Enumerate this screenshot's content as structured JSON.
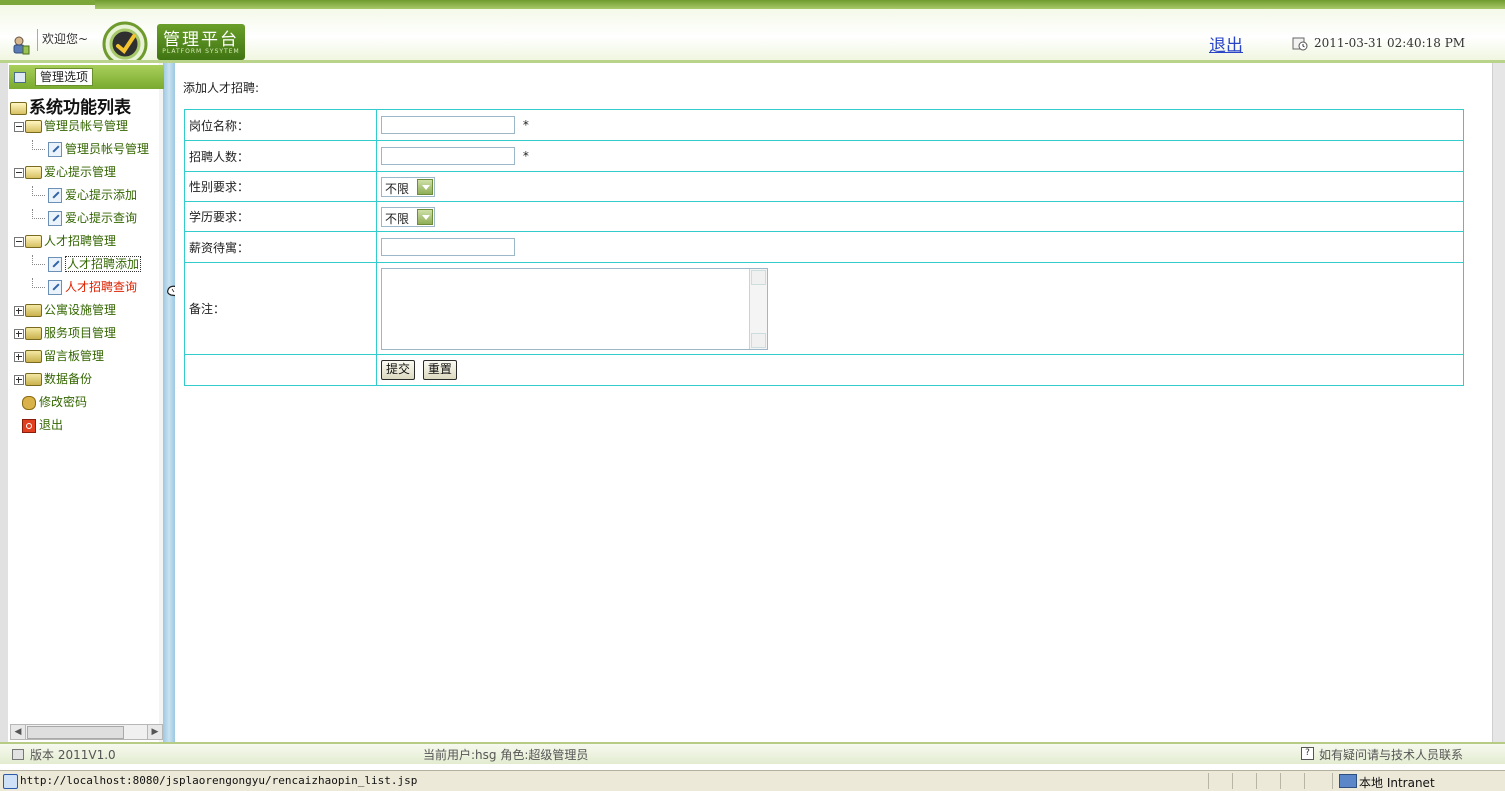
{
  "header": {
    "welcome": "欢迎您~",
    "brand_title": "管理平台",
    "brand_sub": "PLATFORM SYSYTEM",
    "logout": "退出",
    "datetime": "2011-03-31 02:40:18 PM"
  },
  "sidebar": {
    "tab_label": "管理选项",
    "root_label": "系统功能列表",
    "items": [
      {
        "label": "管理员帐号管理"
      },
      {
        "label": "管理员帐号管理"
      },
      {
        "label": "爱心提示管理"
      },
      {
        "label": "爱心提示添加"
      },
      {
        "label": "爱心提示查询"
      },
      {
        "label": "人才招聘管理"
      },
      {
        "label": "人才招聘添加"
      },
      {
        "label": "人才招聘查询"
      },
      {
        "label": "公寓设施管理"
      },
      {
        "label": "服务项目管理"
      },
      {
        "label": "留言板管理"
      },
      {
        "label": "数据备份"
      },
      {
        "label": "修改密码"
      },
      {
        "label": "退出"
      }
    ]
  },
  "main": {
    "title": "添加人才招聘:",
    "fields": {
      "position_label": "岗位名称：",
      "count_label": "招聘人数：",
      "gender_label": "性别要求：",
      "gender_value": "不限",
      "education_label": "学历要求：",
      "education_value": "不限",
      "salary_label": "薪资待寓：",
      "remark_label": "备注：",
      "required_mark": "*"
    },
    "submit": "提交",
    "reset": "重置"
  },
  "footer": {
    "version": "版本 2011V1.0",
    "current_user": "当前用户:hsg  角色:超级管理员",
    "help": "如有疑问请与技术人员联系"
  },
  "statusbar": {
    "url": "http://localhost:8080/jsplaorengongyu/rencaizhaopin_list.jsp",
    "zone": "本地 Intranet"
  },
  "colors": {
    "header_green": "#7aa63a",
    "table_border": "#33cccc",
    "tree_text": "#336600",
    "active_item": "#dd2200",
    "logout_link": "#2a44c8"
  }
}
